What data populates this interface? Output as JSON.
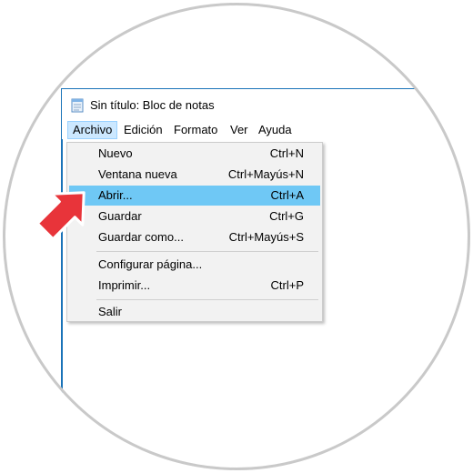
{
  "window": {
    "title": "Sin título: Bloc de notas",
    "app_icon": "notepad-icon"
  },
  "menubar": {
    "items": [
      {
        "label": "Archivo",
        "active": true
      },
      {
        "label": "Edición"
      },
      {
        "label": "Formato"
      },
      {
        "label": "Ver"
      },
      {
        "label": "Ayuda"
      }
    ]
  },
  "archivo_menu": {
    "items": [
      {
        "label": "Nuevo",
        "shortcut": "Ctrl+N"
      },
      {
        "label": "Ventana nueva",
        "shortcut": "Ctrl+Mayús+N"
      },
      {
        "label": "Abrir...",
        "shortcut": "Ctrl+A",
        "highlighted": true
      },
      {
        "label": "Guardar",
        "shortcut": "Ctrl+G"
      },
      {
        "label": "Guardar como...",
        "shortcut": "Ctrl+Mayús+S"
      },
      {
        "label": "Configurar página...",
        "shortcut": ""
      },
      {
        "label": "Imprimir...",
        "shortcut": "Ctrl+P"
      },
      {
        "label": "Salir",
        "shortcut": ""
      }
    ]
  },
  "pointer": {
    "icon": "red-arrow-icon",
    "color": "#e8343a"
  },
  "colors": {
    "highlight": "#6fc8f5",
    "menu_active": "#cce8ff",
    "window_border": "#1a73b8"
  }
}
